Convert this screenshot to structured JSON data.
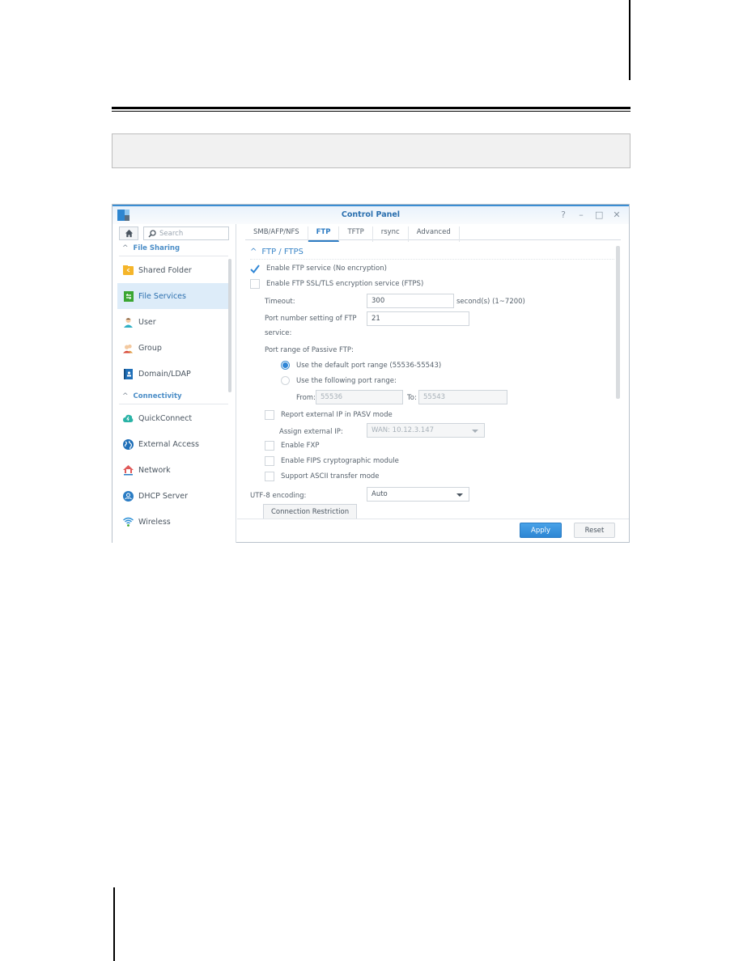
{
  "window": {
    "title": "Control Panel",
    "controls": {
      "help": "?",
      "minimize": "–",
      "maximize": "□",
      "close": "✕"
    }
  },
  "sidebar": {
    "search_placeholder": "Search",
    "sections": [
      {
        "label": "File Sharing",
        "items": [
          {
            "label": "Shared Folder",
            "icon": "shared-folder-icon",
            "active": false
          },
          {
            "label": "File Services",
            "icon": "file-services-icon",
            "active": true
          },
          {
            "label": "User",
            "icon": "user-icon",
            "active": false
          },
          {
            "label": "Group",
            "icon": "group-icon",
            "active": false
          },
          {
            "label": "Domain/LDAP",
            "icon": "domain-ldap-icon",
            "active": false
          }
        ]
      },
      {
        "label": "Connectivity",
        "items": [
          {
            "label": "QuickConnect",
            "icon": "quickconnect-icon",
            "active": false
          },
          {
            "label": "External Access",
            "icon": "globe-icon",
            "active": false
          },
          {
            "label": "Network",
            "icon": "network-house-icon",
            "active": false
          },
          {
            "label": "DHCP Server",
            "icon": "dhcp-server-icon",
            "active": false
          },
          {
            "label": "Wireless",
            "icon": "wifi-icon",
            "active": false
          }
        ]
      }
    ]
  },
  "tabs": [
    {
      "label": "SMB/AFP/NFS",
      "active": false
    },
    {
      "label": "FTP",
      "active": true
    },
    {
      "label": "TFTP",
      "active": false
    },
    {
      "label": "rsync",
      "active": false
    },
    {
      "label": "Advanced",
      "active": false
    }
  ],
  "ftp": {
    "section_title": "FTP / FTPS",
    "enable_ftp": {
      "label": "Enable FTP service (No encryption)",
      "checked": true
    },
    "enable_ftps": {
      "label": "Enable FTP SSL/TLS encryption service (FTPS)",
      "checked": false
    },
    "timeout": {
      "label": "Timeout:",
      "value": "300",
      "suffix": "second(s) (1~7200)"
    },
    "port": {
      "label_line1": "Port number setting of FTP",
      "label_line2": "service:",
      "value": "21"
    },
    "passive": {
      "label": "Port range of Passive FTP:",
      "default_option": {
        "label": "Use the default port range (55536-55543)",
        "selected": true
      },
      "custom_option": {
        "label": "Use the following port range:",
        "selected": false
      },
      "from_label": "From:",
      "from_value": "55536",
      "to_label": "To:",
      "to_value": "55543"
    },
    "report_external_ip": {
      "label": "Report external IP in PASV mode",
      "checked": false
    },
    "assign_external_ip": {
      "label": "Assign external IP:",
      "value": "WAN: 10.12.3.147"
    },
    "enable_fxp": {
      "label": "Enable FXP",
      "checked": false
    },
    "enable_fips": {
      "label": "Enable FIPS cryptographic module",
      "checked": false
    },
    "ascii_mode": {
      "label": "Support ASCII transfer mode",
      "checked": false
    },
    "utf8": {
      "label": "UTF-8 encoding:",
      "value": "Auto"
    },
    "connection_restriction_label": "Connection Restriction"
  },
  "footer": {
    "apply_label": "Apply",
    "reset_label": "Reset"
  },
  "colors": {
    "accent": "#2f86d6",
    "active_nav_bg": "#ddecf9",
    "section_head": "#4a8dc7"
  }
}
